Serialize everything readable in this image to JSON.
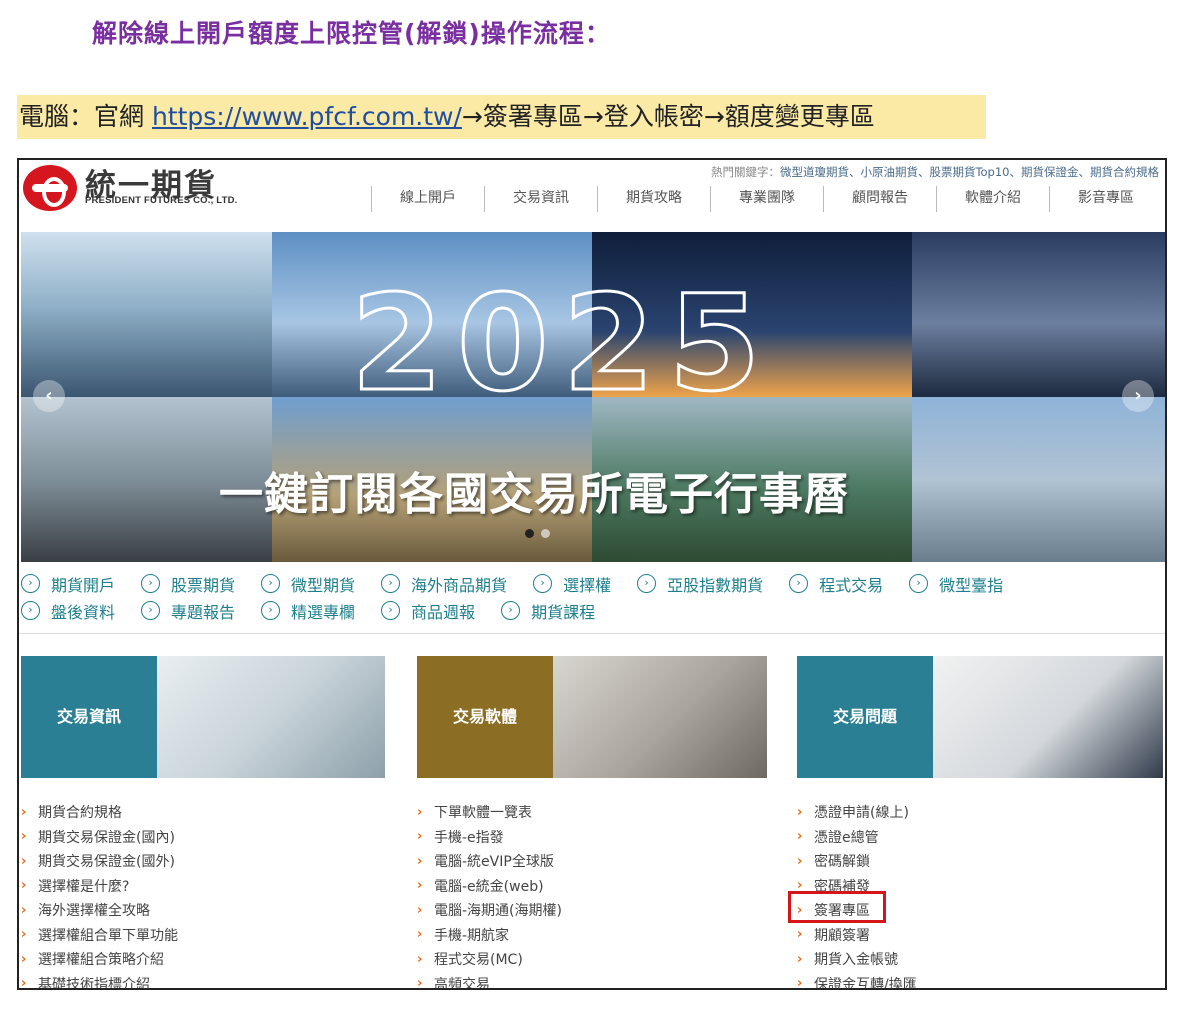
{
  "doc": {
    "title": "解除線上開戶額度上限控管(解鎖)操作流程：",
    "route_prefix": "電腦：官網 ",
    "route_url": "https://www.pfcf.com.tw/",
    "route_suffix": "→簽署專區→登入帳密→額度變更專區"
  },
  "site": {
    "logo_cn": "統一期貨",
    "logo_en": "PRESIDENT FUTURES CO., LTD.",
    "hotkeys_label": "熱門關鍵字：",
    "hotkeys": "微型道瓊期貨、小原油期貨、股票期貨Top10、期貨保證金、期貨合約規格",
    "nav": [
      "線上開戶",
      "交易資訊",
      "期貨攻略",
      "專業團隊",
      "顧問報告",
      "軟體介紹",
      "影音專區"
    ]
  },
  "banner": {
    "year": "2025",
    "slogan": "一鍵訂閱各國交易所電子行事曆",
    "prev": "‹",
    "next": "›"
  },
  "quick_links": {
    "row1": [
      "期貨開戶",
      "股票期貨",
      "微型期貨",
      "海外商品期貨",
      "選擇權",
      "亞股指數期貨",
      "程式交易",
      "微型臺指"
    ],
    "row2": [
      "盤後資料",
      "專題報告",
      "精選專欄",
      "商品週報",
      "期貨課程"
    ],
    "icon": "›"
  },
  "cards": {
    "trade_info": {
      "label": "交易資訊",
      "color": "#2a7f94"
    },
    "trade_software": {
      "label": "交易軟體",
      "color": "#8c6d24"
    },
    "trade_issues": {
      "label": "交易問題",
      "color": "#2a7f94"
    }
  },
  "lists": {
    "chevron": "›",
    "trade_info": [
      "期貨合約規格",
      "期貨交易保證金(國內)",
      "期貨交易保證金(國外)",
      "選擇權是什麼?",
      "海外選擇權全攻略",
      "選擇權組合單下單功能",
      "選擇權組合策略介紹",
      "基礎技術指標介紹"
    ],
    "trade_software": [
      "下單軟體一覽表",
      "手機-e指發",
      "電腦-統eVIP全球版",
      "電腦-e統金(web)",
      "電腦-海期通(海期權)",
      "手機-期航家",
      "程式交易(MC)",
      "高頻交易"
    ],
    "trade_issues": [
      "憑證申請(線上)",
      "憑證e總管",
      "密碼解鎖",
      "密碼補發",
      "簽署專區",
      "期顧簽署",
      "期貨入金帳號",
      "保證金互轉/換匯"
    ]
  },
  "colors": {
    "accent_title": "#7a2fa0",
    "route_bg": "#fbe9a6",
    "link": "#1e7f8c",
    "chevron": "#e46b19",
    "highlight_box": "#d4161b"
  }
}
